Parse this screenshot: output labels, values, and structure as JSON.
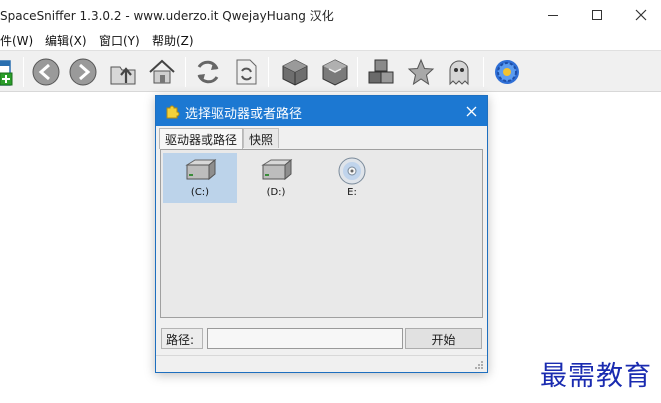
{
  "window": {
    "title": "SpaceSniffer 1.3.0.2 - www.uderzo.it  QwejayHuang 汉化"
  },
  "menu": {
    "items": [
      "件(W)",
      "编辑(X)",
      "窗口(Y)",
      "帮助(Z)"
    ]
  },
  "toolbar": {
    "icons": [
      "new-window-icon",
      "back-icon",
      "forward-icon",
      "up-folder-icon",
      "home-icon",
      "refresh-icon",
      "refresh-page-icon",
      "cube-icon",
      "cube-outline-icon",
      "blocks-icon",
      "star-icon",
      "ghost-icon",
      "gear-flower-icon"
    ]
  },
  "dialog": {
    "title": "选择驱动器或者路径",
    "tabs": [
      "驱动器或路径",
      "快照"
    ],
    "drives": [
      {
        "label": "(C:)",
        "icon": "hard-drive-icon",
        "selected": true
      },
      {
        "label": "(D:)",
        "icon": "hard-drive-icon",
        "selected": false
      },
      {
        "label": "E:",
        "icon": "cd-drive-icon",
        "selected": false
      }
    ],
    "path_label": "路径:",
    "path_value": "",
    "start_label": "开始"
  },
  "watermark": "最需教育",
  "colors": {
    "dialog_title_bg": "#1c78d2",
    "selection_bg": "#bcd3ea",
    "watermark": "#1a2bb0"
  }
}
